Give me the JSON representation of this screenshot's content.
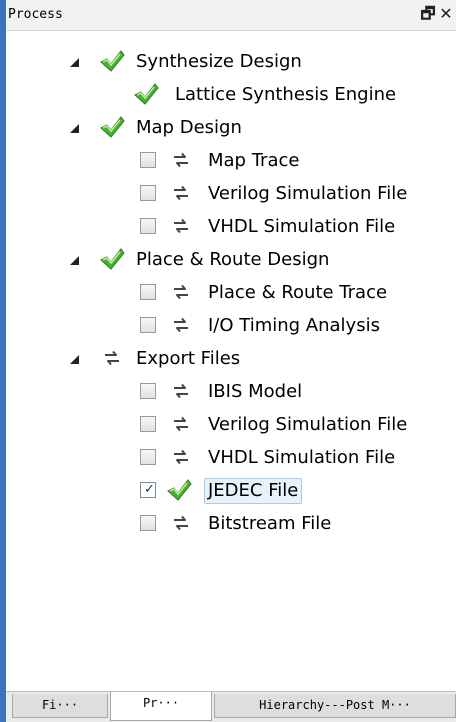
{
  "panel": {
    "title": "Process",
    "restore_label": "🗗",
    "close_label": "✕"
  },
  "tree": {
    "items": [
      {
        "label": "Synthesize Design",
        "level": 0,
        "expandable": true,
        "icon": "green-check-icon",
        "checkbox": null
      },
      {
        "label": "Lattice Synthesis Engine",
        "level": 1,
        "expandable": false,
        "icon": "green-check-icon",
        "checkbox": null
      },
      {
        "label": "Map Design",
        "level": 0,
        "expandable": true,
        "icon": "green-check-icon",
        "checkbox": null
      },
      {
        "label": "Map Trace",
        "level": 1,
        "expandable": false,
        "icon": "refresh-icon",
        "checkbox": false
      },
      {
        "label": "Verilog Simulation File",
        "level": 1,
        "expandable": false,
        "icon": "refresh-icon",
        "checkbox": false
      },
      {
        "label": "VHDL Simulation File",
        "level": 1,
        "expandable": false,
        "icon": "refresh-icon",
        "checkbox": false
      },
      {
        "label": "Place & Route Design",
        "level": 0,
        "expandable": true,
        "icon": "green-check-icon",
        "checkbox": null
      },
      {
        "label": "Place & Route Trace",
        "level": 1,
        "expandable": false,
        "icon": "refresh-icon",
        "checkbox": false
      },
      {
        "label": "I/O Timing Analysis",
        "level": 1,
        "expandable": false,
        "icon": "refresh-icon",
        "checkbox": false
      },
      {
        "label": "Export Files",
        "level": 0,
        "expandable": true,
        "icon": "refresh-icon",
        "checkbox": null
      },
      {
        "label": "IBIS Model",
        "level": 1,
        "expandable": false,
        "icon": "refresh-icon",
        "checkbox": false
      },
      {
        "label": "Verilog Simulation File",
        "level": 1,
        "expandable": false,
        "icon": "refresh-icon",
        "checkbox": false
      },
      {
        "label": "VHDL Simulation File",
        "level": 1,
        "expandable": false,
        "icon": "refresh-icon",
        "checkbox": false
      },
      {
        "label": "JEDEC File",
        "level": 1,
        "expandable": false,
        "icon": "green-check-icon",
        "checkbox": true,
        "selected": true
      },
      {
        "label": "Bitstream File",
        "level": 1,
        "expandable": false,
        "icon": "refresh-icon",
        "checkbox": false
      }
    ]
  },
  "tabs": [
    {
      "label": "Fi···",
      "active": false
    },
    {
      "label": "Pr···",
      "active": true
    },
    {
      "label": "Hierarchy---Post M···",
      "active": false
    }
  ],
  "colors": {
    "accent": "#3f73b8",
    "check_green": "#3fa52d",
    "selection": "#e8f2fb"
  }
}
